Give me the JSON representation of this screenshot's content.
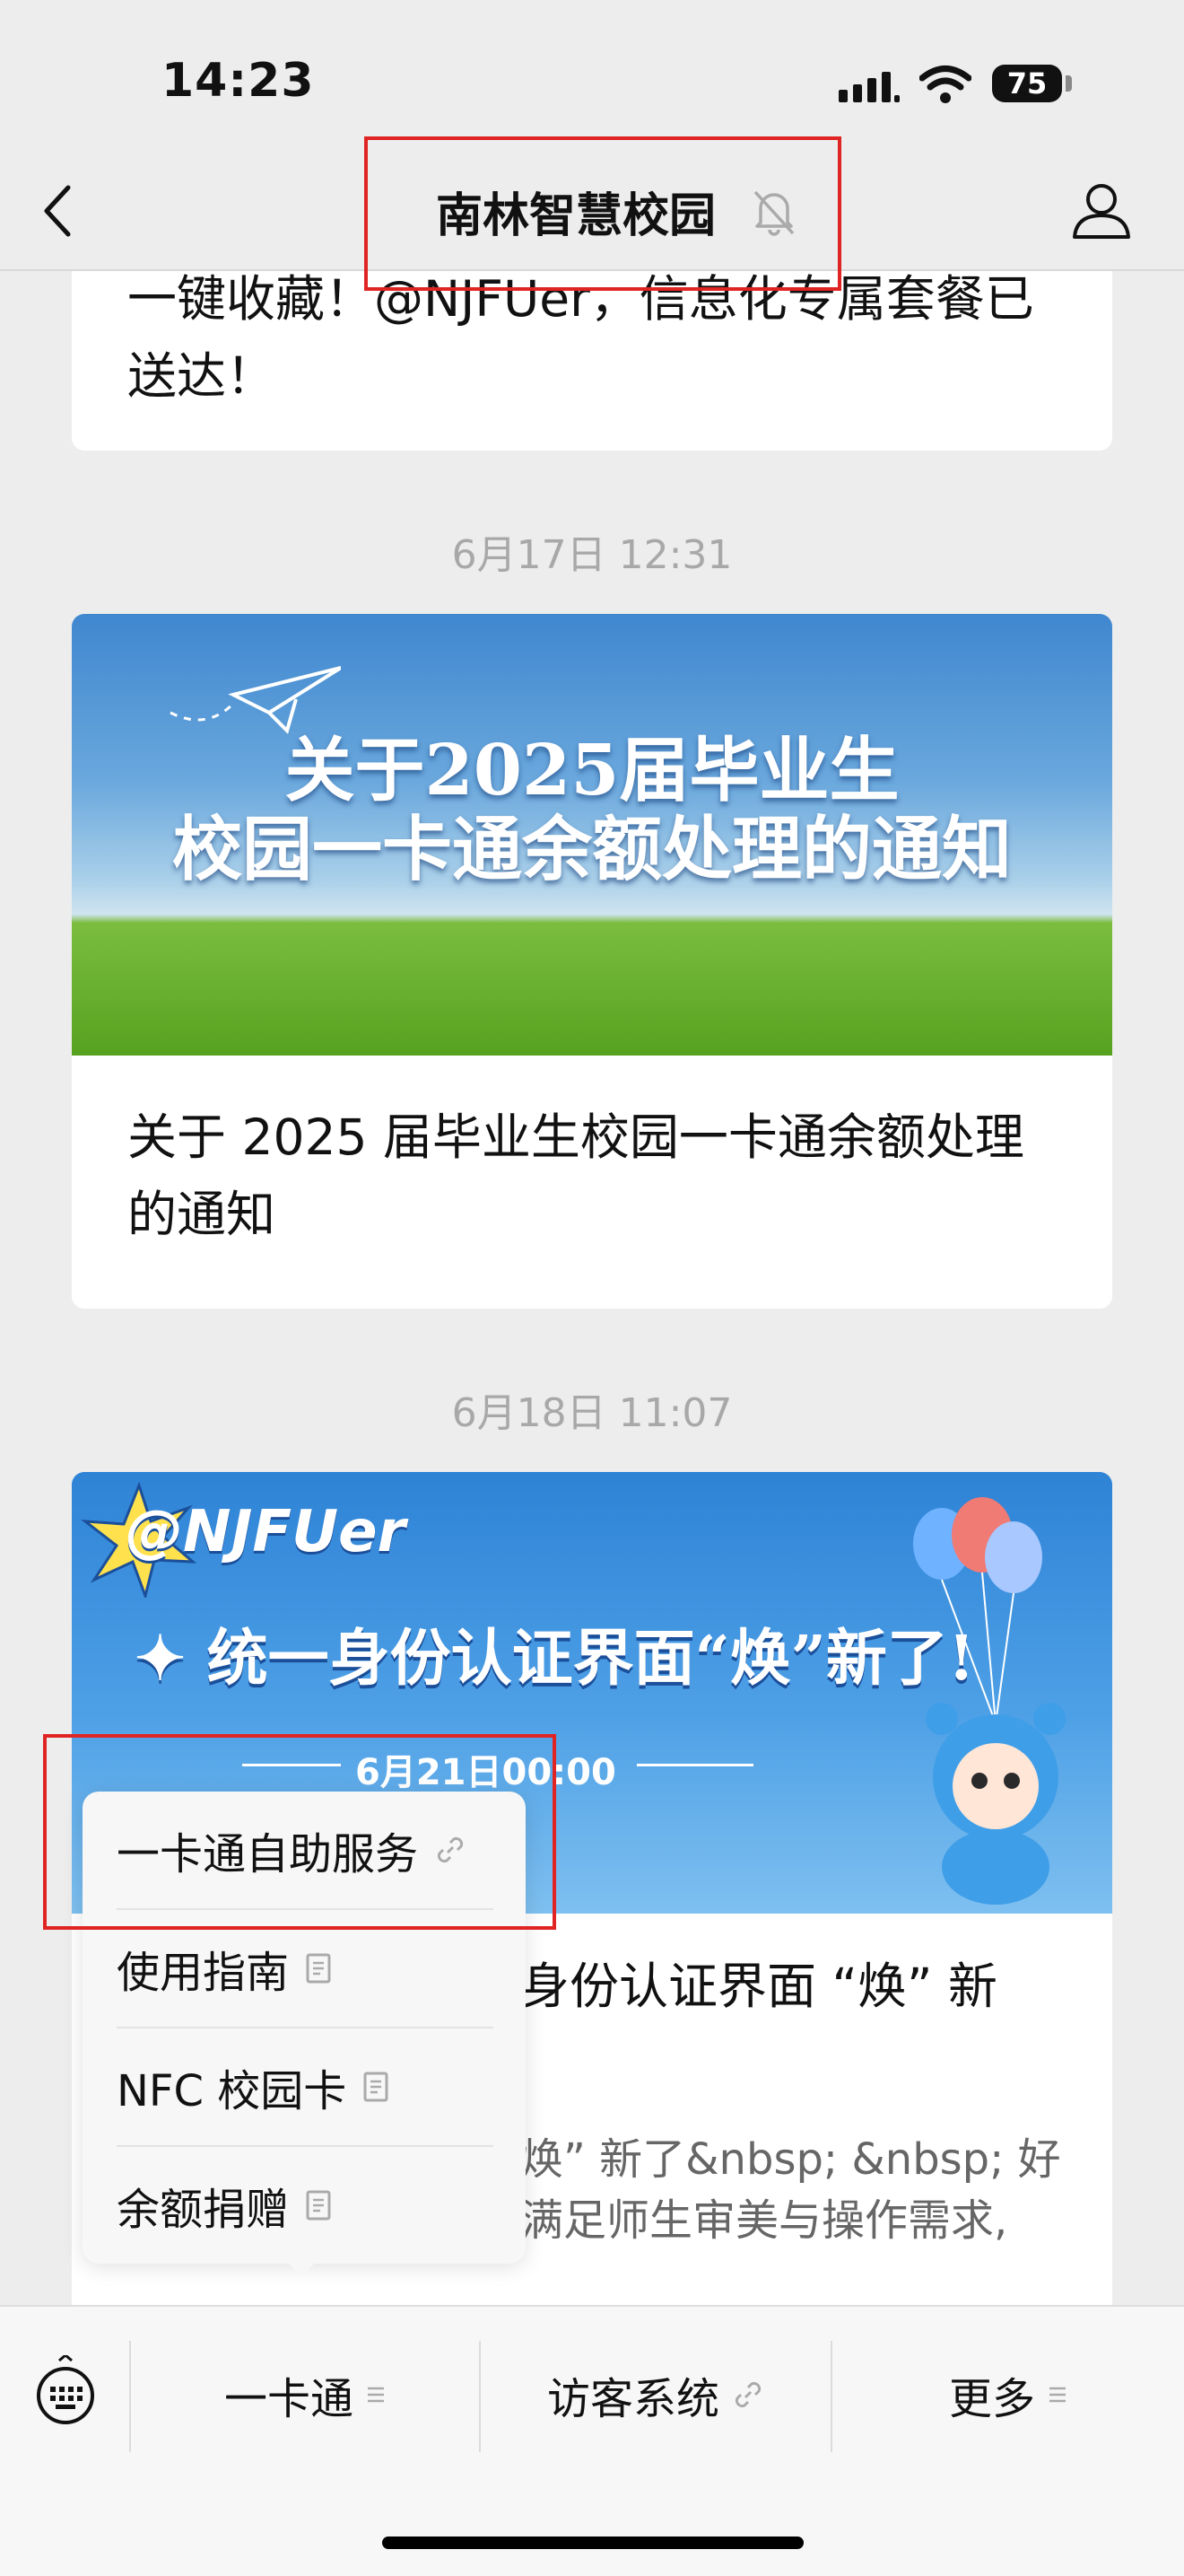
{
  "status_bar": {
    "time": "14:23",
    "battery": "75"
  },
  "header": {
    "title": "南林智慧校园"
  },
  "feed": {
    "prev_card_title": "一键收藏！@NJFUer，信息化专属套餐已送达！",
    "timestamp_1": "6月17日 12:31",
    "card_1": {
      "banner_line1": "关于2025届毕业生",
      "banner_line2": "校园一卡通余额处理的通知",
      "title": "关于 2025 届毕业生校园一卡通余额处理的通知"
    },
    "timestamp_2": "6月18日 11:07",
    "card_2": {
      "banner_brand": "@NJFUer",
      "banner_headline": "✦ 统一身份认证界面“焕”新了!",
      "banner_date": "6月21日00:00",
      "title": "身份认证界面 “焕” 新",
      "summary": "焕” 新了&nbsp; &nbsp; 好满足师生审美与操作需求,"
    }
  },
  "popup_menu": {
    "items": [
      {
        "label": "一卡通自助服务",
        "icon": "link-icon"
      },
      {
        "label": "使用指南",
        "icon": "article-icon"
      },
      {
        "label": "NFC 校园卡",
        "icon": "article-icon"
      },
      {
        "label": "余额捐赠",
        "icon": "article-icon"
      }
    ]
  },
  "bottom_menu": {
    "tabs": [
      {
        "label": "一卡通",
        "icon": "menu-lines-icon"
      },
      {
        "label": "访客系统",
        "icon": "link-icon"
      },
      {
        "label": "更多",
        "icon": "menu-lines-icon"
      }
    ]
  },
  "colors": {
    "highlight": "#e02424",
    "background": "#ededed",
    "muted_text": "#a8a8a8"
  }
}
